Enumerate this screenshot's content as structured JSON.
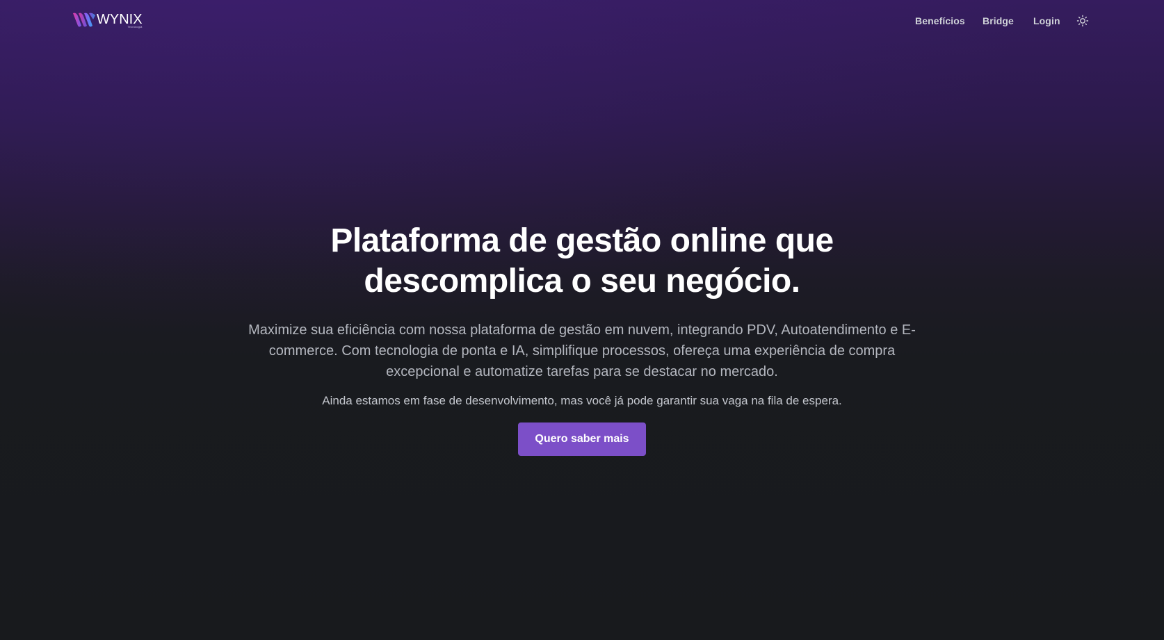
{
  "brand": {
    "name": "WYNIX",
    "tagline": "Tecnologia",
    "colors": {
      "accent": "#7c4fc8",
      "logo_gradient_start": "#e63aa4",
      "logo_gradient_end": "#6a5cf0",
      "background_top": "#351c5e",
      "background_bottom": "#181a1d"
    }
  },
  "nav": {
    "items": [
      {
        "label": "Benefícios"
      },
      {
        "label": "Bridge"
      },
      {
        "label": "Login"
      }
    ],
    "theme_toggle_icon": "sun-icon"
  },
  "hero": {
    "title": "Plataforma de gestão online que descomplica o seu negócio.",
    "description": "Maximize sua eficiência com nossa plataforma de gestão em nuvem, integrando PDV, Autoatendimento e E-commerce. Com tecnologia de ponta e IA, simplifique processos, ofereça uma experiência de compra excepcional e automatize tarefas para se destacar no mercado.",
    "note": "Ainda estamos em fase de desenvolvimento, mas você já pode garantir sua vaga na fila de espera.",
    "cta_label": "Quero saber mais"
  }
}
